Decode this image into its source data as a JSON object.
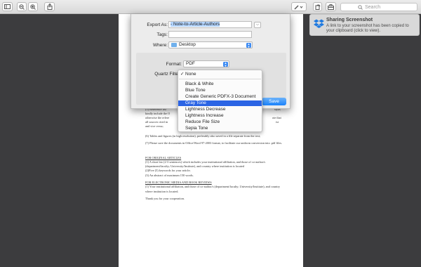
{
  "toolbar": {
    "search_placeholder": "Search",
    "buttons": [
      "sidebar-icon",
      "zoom-out-icon",
      "zoom-in-icon",
      "share-icon",
      "pencil-icon",
      "rotate-icon",
      "toolbox-icon",
      "search-icon"
    ]
  },
  "export_sheet": {
    "export_as_label": "Export As:",
    "export_as_value": "- Note-to-Article-Authors",
    "tags_label": "Tags:",
    "tags_value": "",
    "where_label": "Where:",
    "where_value": "Desktop",
    "format_label": "Format:",
    "format_value": "PDF",
    "quartz_label": "Quartz Filter",
    "save_label": "Save"
  },
  "quartz_menu": {
    "items": [
      {
        "label": "None",
        "checked": true
      },
      {
        "label": "Black & White"
      },
      {
        "label": "Blue Tone"
      },
      {
        "label": "Create Generic PDFX-3 Document"
      },
      {
        "label": "Gray Tone",
        "highlighted": true
      },
      {
        "label": "Lightness Decrease"
      },
      {
        "label": "Lightness Increase"
      },
      {
        "label": "Reduce File Size"
      },
      {
        "label": "Sepia Tone"
      }
    ]
  },
  "notification": {
    "title": "Sharing Screenshot",
    "body": "A link to your screenshot has been copied to your clipboard (click to view)."
  },
  "document": {
    "fragments": {
      "l1_left": "(5) Reference list",
      "l1_right": "style;",
      "l2": "kindly include the O",
      "l3_left": "otherwise the refere",
      "l3_right": "ote that",
      "l4_left": "all sources cited in",
      "l4_right": "ist",
      "l5": "and vice versa;"
    },
    "p6": "(6) Tables and figures (in high resolution), preferably also saved in a file separate from the text;",
    "p7": "(7) Please save the documents in Office/Word 97-2003 format, to facilitate our uniform conversion into .pdf files.",
    "h_original": "FOR ORIGINAL ARTICLES",
    "o1": "(1) A short bio (2-3 sentences) which includes your institutional affiliation, and those of co-author/s (department/faculty; University/Institute), and country where institution is located",
    "o2": "(2)Five (5) keywords for your article;",
    "o3": "(3) An abstract of maximum 150 words.",
    "h_reviews": "FOR ELECTRONIC MEDIA AND BOOK REVIEWS",
    "r1": "(1) Your institutional affiliation, and those of co-author/s (department/faculty; University/Institute), and country where institution is located.",
    "thanks": "Thank you for your cooperation."
  },
  "colors": {
    "accent": "#2b64e4",
    "save_button": "#1a82fb",
    "background": "#3c3c3e"
  }
}
